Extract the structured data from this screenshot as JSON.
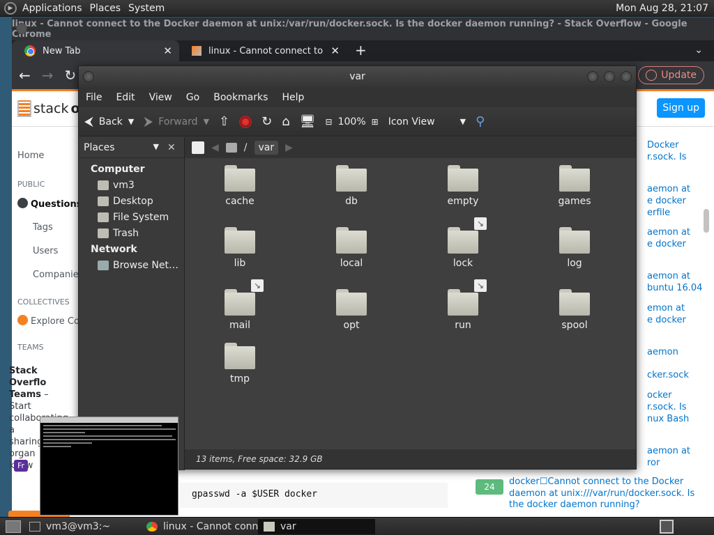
{
  "top_panel": {
    "menus": [
      "Applications",
      "Places",
      "System"
    ],
    "clock": "Mon Aug 28, 21:07"
  },
  "chrome": {
    "window_title": "linux - Cannot connect to the Docker daemon at unix:/var/run/docker.sock. Is the docker daemon running? - Stack Overflow - Google Chrome",
    "tabs": [
      {
        "label": "New Tab",
        "active": true
      },
      {
        "label": "linux - Cannot connect to the D",
        "active": false
      }
    ],
    "update_label": "Update",
    "page": {
      "logo_text_a": "stack",
      "logo_text_b": "ov",
      "signup_label": "Sign up",
      "left_nav": {
        "home": "Home",
        "public": "PUBLIC",
        "questions": "Questions",
        "tags": "Tags",
        "users": "Users",
        "companies": "Companies",
        "collectives": "COLLECTIVES",
        "explore": "Explore Co",
        "teams": "TEAMS"
      },
      "teams_box": {
        "title_a": "Stack Overflo",
        "title_b": "Teams",
        "line_a": " – Start",
        "line_b": "collaborating a",
        "line_c": "sharing organ",
        "line_d": "know"
      },
      "free_btn": "Fr",
      "right_links": [
        "Docker",
        "r.sock. Is",
        "aemon at",
        "e docker",
        "erfile",
        "aemon at",
        "e docker",
        "aemon at",
        "buntu 16.04",
        "emon at",
        "e docker",
        "aemon",
        "cker.sock",
        "ocker",
        "r.sock. Is",
        "nux Bash",
        "aemon at",
        "ror"
      ],
      "code_line": "gpasswd -a $USER docker",
      "related_votes": "24",
      "related_text": "docker☐Cannot connect to the Docker daemon at unix:///var/run/docker.sock. Is the docker daemon running?"
    }
  },
  "file_manager": {
    "window_title": "var",
    "menus": [
      "File",
      "Edit",
      "View",
      "Go",
      "Bookmarks",
      "Help"
    ],
    "toolbar": {
      "back": "Back",
      "forward": "Forward",
      "zoom": "100%",
      "view_mode": "Icon View"
    },
    "sidebar": {
      "selector": "Places",
      "computer_header": "Computer",
      "computer_items": [
        "vm3",
        "Desktop",
        "File System",
        "Trash"
      ],
      "network_header": "Network",
      "network_items": [
        "Browse Net…"
      ]
    },
    "location": {
      "separator": "/",
      "current": "var"
    },
    "items": [
      {
        "name": "cache",
        "link": false
      },
      {
        "name": "db",
        "link": false
      },
      {
        "name": "empty",
        "link": false
      },
      {
        "name": "games",
        "link": false
      },
      {
        "name": "lib",
        "link": false
      },
      {
        "name": "local",
        "link": false
      },
      {
        "name": "lock",
        "link": true
      },
      {
        "name": "log",
        "link": false
      },
      {
        "name": "mail",
        "link": true
      },
      {
        "name": "opt",
        "link": false
      },
      {
        "name": "run",
        "link": true
      },
      {
        "name": "spool",
        "link": false
      },
      {
        "name": "tmp",
        "link": false
      }
    ],
    "status": "13 items, Free space: 32.9 GB"
  },
  "bottom_panel": {
    "tasks": [
      {
        "label": "vm3@vm3:~",
        "active": false
      },
      {
        "label": "linux - Cannot conn…",
        "active": false
      },
      {
        "label": "var",
        "active": true
      }
    ]
  }
}
